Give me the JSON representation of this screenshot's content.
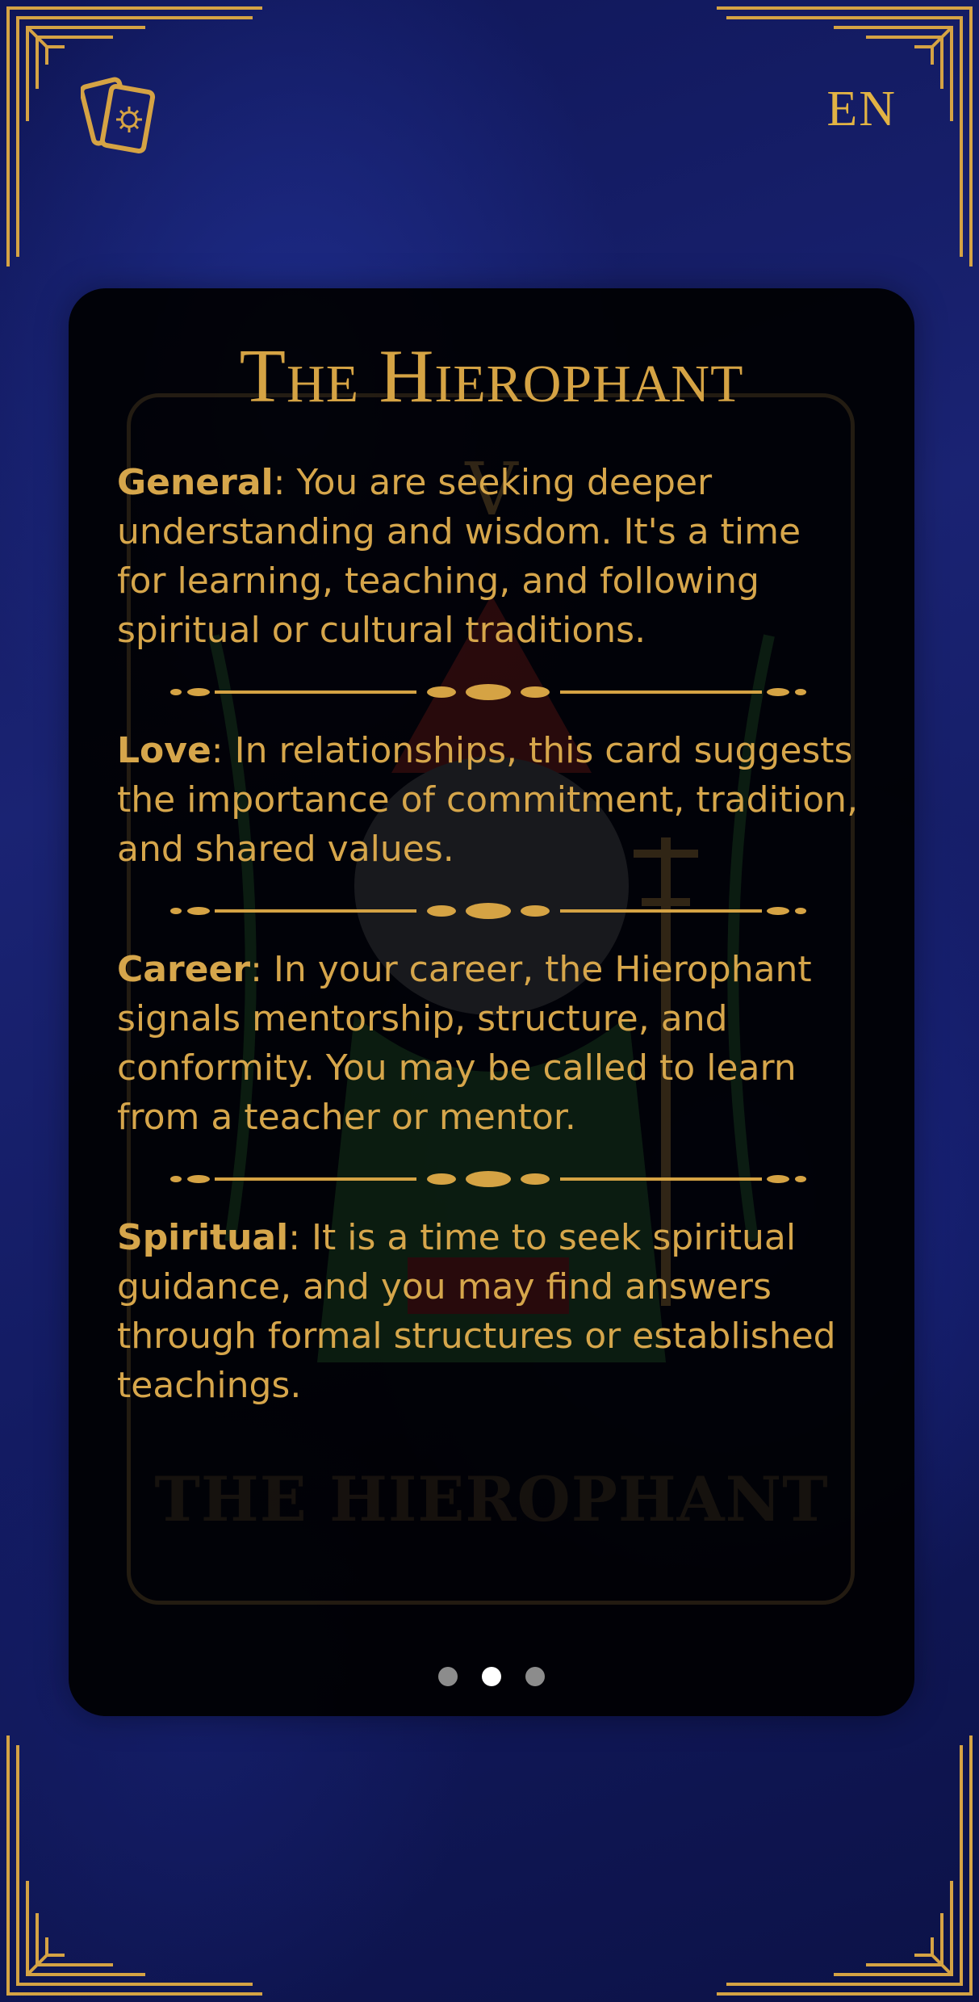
{
  "header": {
    "language": "EN",
    "app_icon": "tarot-cards-icon"
  },
  "card": {
    "title": "The Hierophant",
    "footer_name": "THE HIEROPHANT",
    "numeral": "V"
  },
  "sections": [
    {
      "label": "General",
      "text": ": You are seeking deeper understanding and wisdom. It's a time for learning, teaching, and following spiritual or cultural traditions."
    },
    {
      "label": "Love",
      "text": ": In relationships, this card suggests the importance of commitment, tradition, and shared values."
    },
    {
      "label": "Career",
      "text": ": In your career, the Hierophant signals mentorship, structure, and conformity. You may be called to learn from a teacher or mentor."
    },
    {
      "label": "Spiritual",
      "text": ": It is a time to seek spiritual guidance, and you may find answers through formal structures or established teachings."
    }
  ],
  "pagination": {
    "total": 3,
    "active": 2
  },
  "colors": {
    "gold": "#d6a64b",
    "panel": "#000000",
    "background": "#1a2373"
  }
}
